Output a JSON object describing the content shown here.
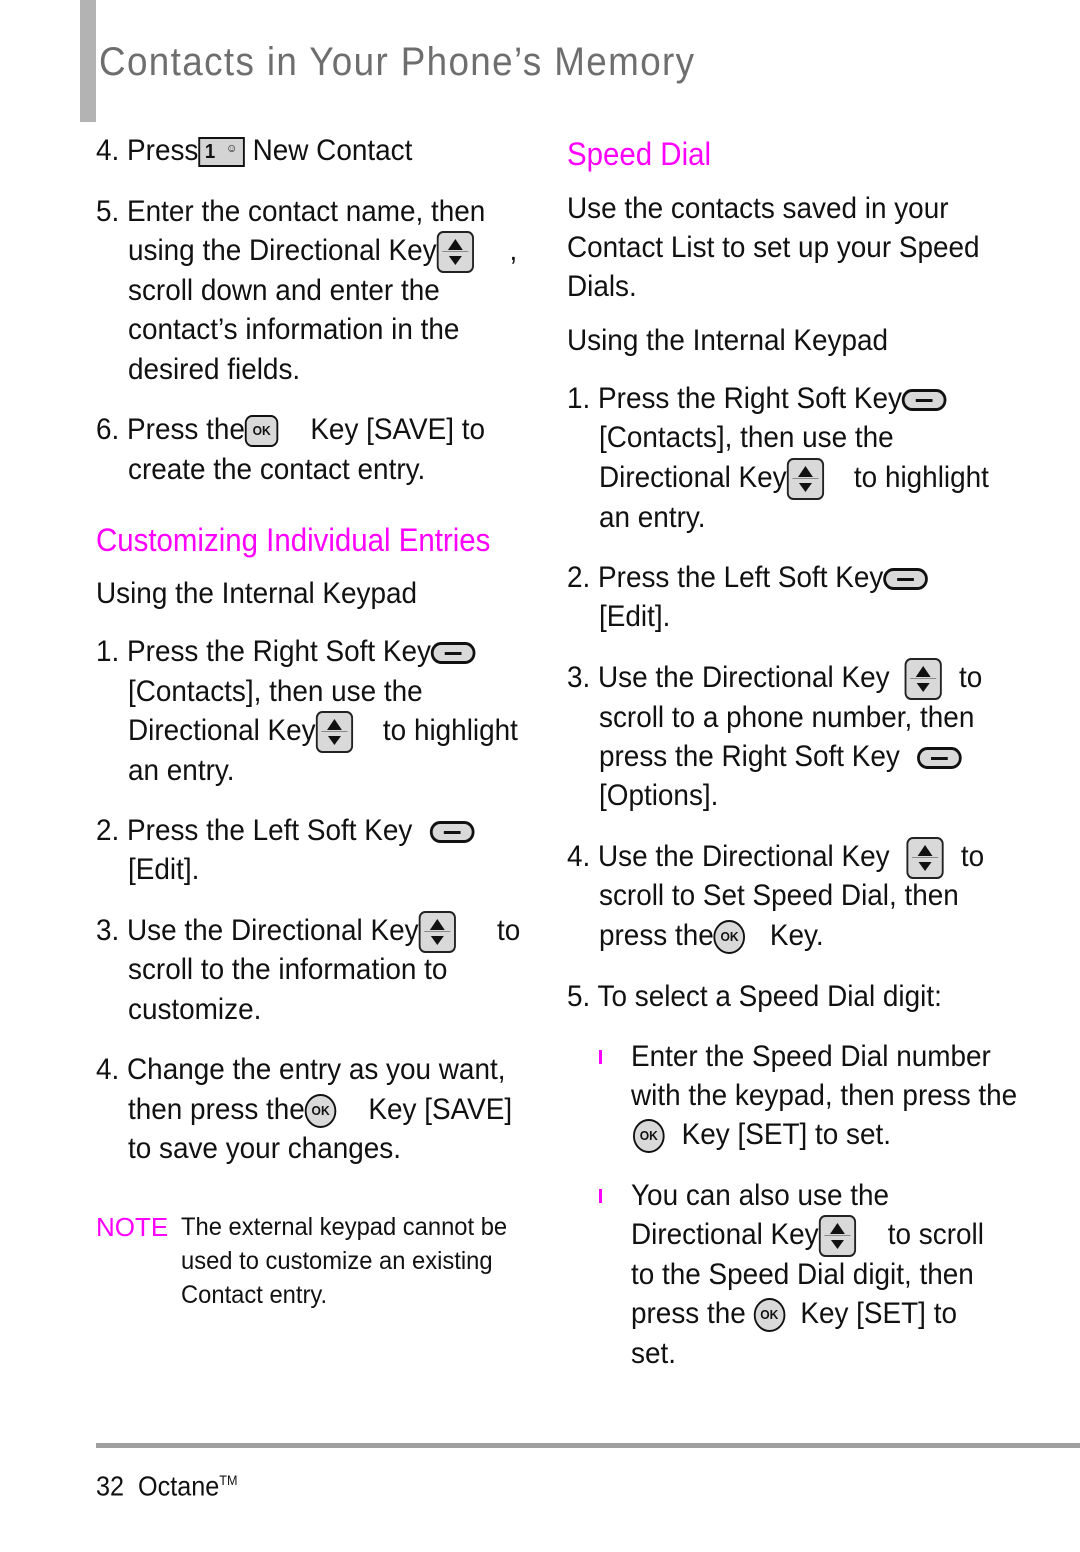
{
  "page": {
    "title": "Contacts in Your Phone’s Memory",
    "footer": {
      "page_number": "32",
      "product": "Octane",
      "trademark": "TM"
    }
  },
  "left_column": {
    "steps_top": [
      {
        "number": "4.",
        "lines": [
          "Press",
          "New Contact"
        ],
        "icon": "key-1-contacts-icon"
      },
      {
        "number": "5.",
        "lines": [
          "Enter the contact name, then",
          "using the Directional Key",
          ",",
          "scroll down and enter the",
          "contact’s information in the",
          "desired fields."
        ]
      },
      {
        "number": "6.",
        "lines": [
          "Press the",
          "Key [SAVE] to",
          "create the contact entry."
        ]
      }
    ],
    "section_heading": "Customizing Individual Entries",
    "subheading": "Using the Internal Keypad",
    "steps": [
      {
        "number": "1.",
        "lines": [
          "Press the Right Soft Key",
          "[Contacts], then use the",
          "Directional Key",
          "to highlight",
          "an entry."
        ]
      },
      {
        "number": "2.",
        "lines": [
          "Press the Left Soft Key",
          "[Edit]."
        ]
      },
      {
        "number": "3.",
        "lines": [
          "Use the Directional Key",
          "to",
          "scroll to the information to",
          "customize."
        ]
      },
      {
        "number": "4.",
        "lines": [
          "Change the entry as you want,",
          "then press the",
          "Key [SAVE]",
          "to save your changes."
        ]
      }
    ],
    "note": {
      "label": "NOTE",
      "lines": [
        "The external keypad cannot be",
        "used to customize an existing",
        "Contact entry."
      ]
    }
  },
  "right_column": {
    "section_heading": "Speed Dial",
    "intro_lines": [
      "Use the contacts saved in your",
      "Contact List to set up your Speed",
      "Dials."
    ],
    "subheading": "Using the Internal Keypad",
    "steps": [
      {
        "number": "1.",
        "lines": [
          "Press the Right Soft Key",
          "[Contacts], then use the",
          "Directional Key",
          "to highlight",
          "an entry."
        ]
      },
      {
        "number": "2.",
        "lines": [
          "Press the Left Soft Key",
          "[Edit]."
        ]
      },
      {
        "number": "3.",
        "lines": [
          "Use the Directional Key",
          "to",
          "scroll to a phone number, then",
          "press the Right Soft Key",
          "[Options]."
        ]
      },
      {
        "number": "4.",
        "lines": [
          "Use the Directional Key",
          "to",
          "scroll to Set Speed Dial, then",
          "press the",
          "Key."
        ]
      },
      {
        "number": "5.",
        "lines": [
          "To select a Speed Dial digit:"
        ]
      }
    ],
    "bullets": [
      {
        "lines": [
          "Enter the Speed Dial number",
          "with the keypad, then press the",
          "Key [SET] to set."
        ]
      },
      {
        "lines": [
          "You can also use the",
          "Directional Key",
          "to scroll",
          "to the Speed Dial digit, then",
          "press the",
          "Key [SET] to",
          "set."
        ]
      }
    ]
  },
  "keys": {
    "ok_label": "OK",
    "one_label": "1"
  },
  "colors": {
    "accent": "#ff00ff",
    "title_gray": "#6e6e6e",
    "side_bar": "#b3b3b3",
    "rule": "#a0a0a0"
  }
}
